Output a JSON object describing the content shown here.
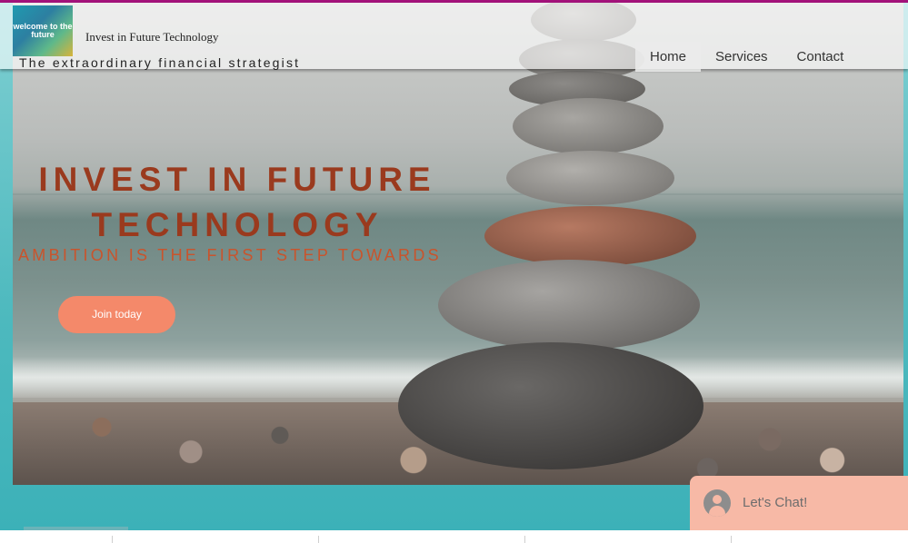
{
  "header": {
    "logo_text": "welcome to the future",
    "site_title": "Invest in Future Technology",
    "tagline": "The extraordinary financial strategist"
  },
  "nav": {
    "items": [
      {
        "label": "Home",
        "active": true
      },
      {
        "label": "Services",
        "active": false
      },
      {
        "label": "Contact",
        "active": false
      }
    ]
  },
  "hero": {
    "headline_line1": "INVEST IN FUTURE",
    "headline_line2": "TECHNOLOGY",
    "subline": "AMBITION IS THE FIRST STEP TOWARDS",
    "cta_label": "Join today"
  },
  "chat": {
    "label": "Let's Chat!",
    "icon": "user-avatar-icon"
  },
  "colors": {
    "accent_bar": "#a3127a",
    "headline": "#9a3a1e",
    "subline": "#c9542c",
    "cta": "#f4896a",
    "chat_bg": "#f7b9a6",
    "teal": "#4db9be"
  }
}
